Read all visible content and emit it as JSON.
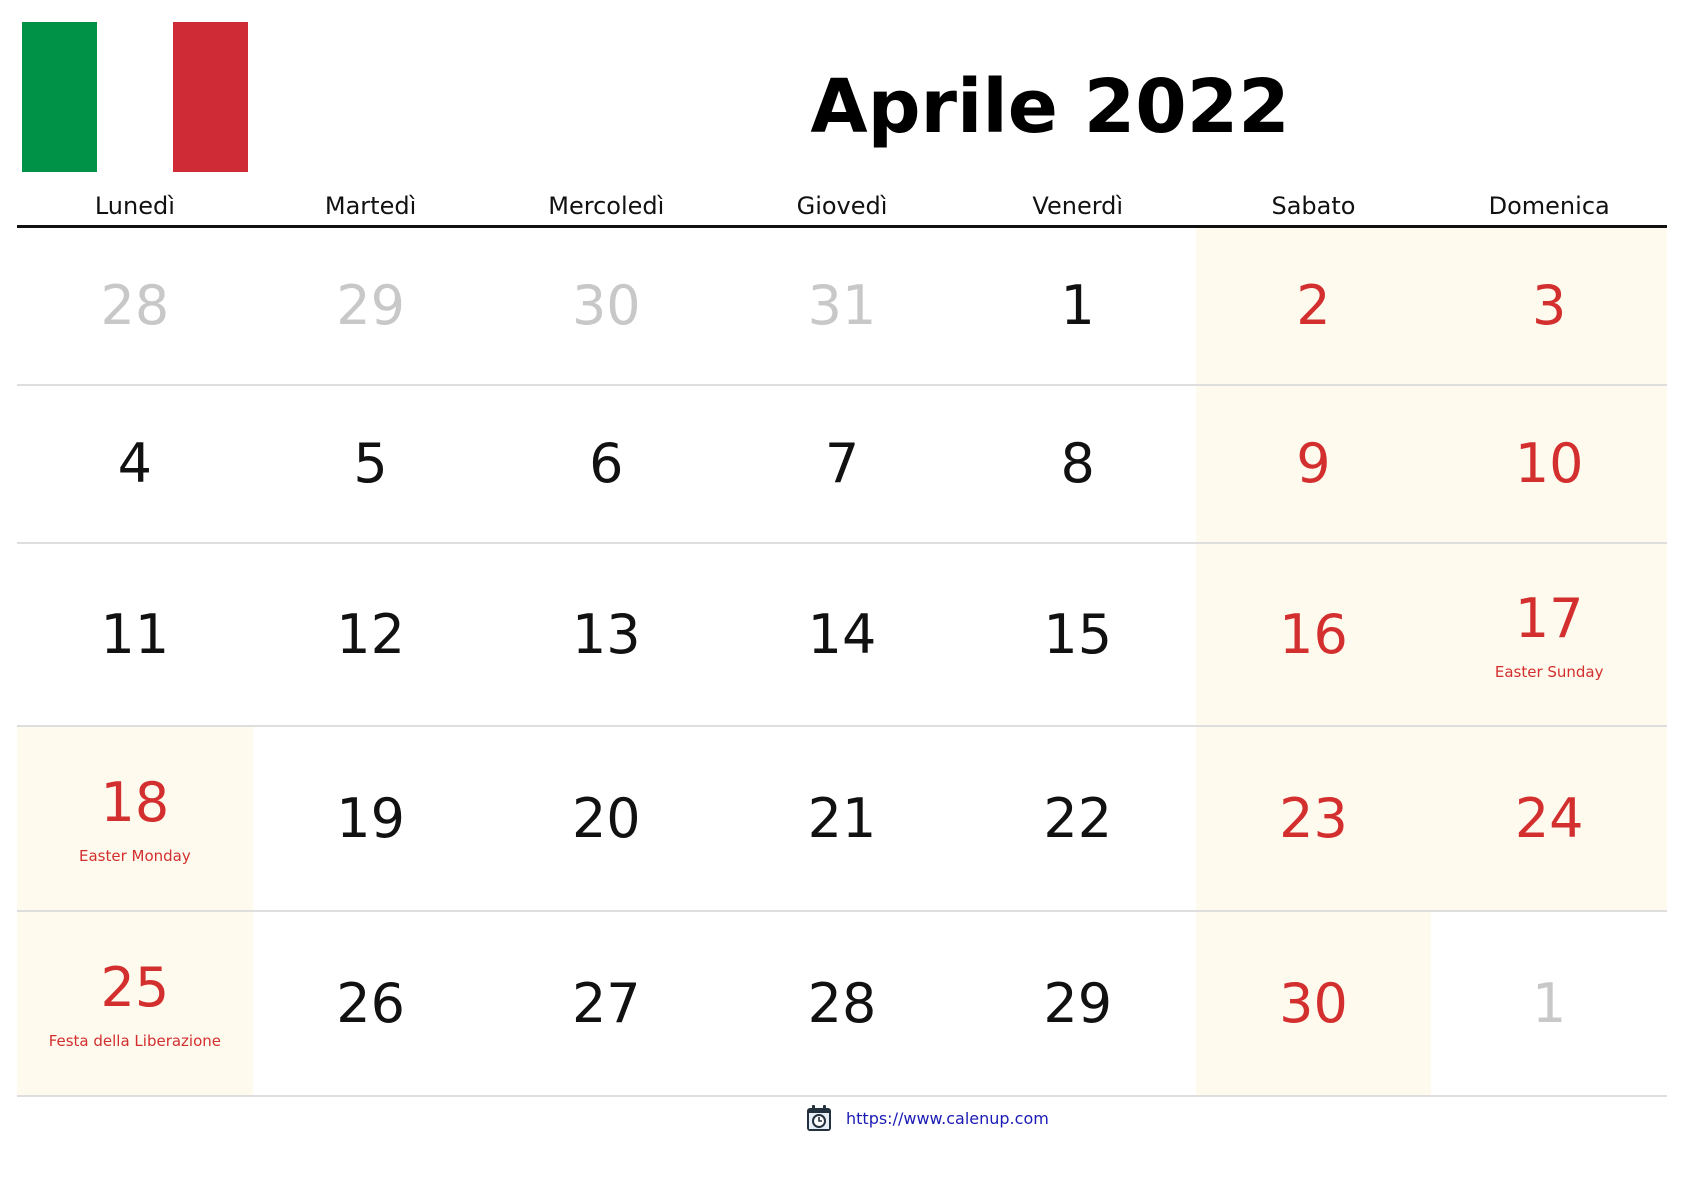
{
  "title": "Aprile 2022",
  "flag": {
    "name": "Italy",
    "colors": [
      "#009246",
      "#ffffff",
      "#ce2b37"
    ]
  },
  "weekdays": [
    "Lunedì",
    "Martedì",
    "Mercoledì",
    "Giovedì",
    "Venerdì",
    "Sabato",
    "Domenica"
  ],
  "colors": {
    "weekend_red": "#d32f2f",
    "muted_gray": "#c8c8c8",
    "weekend_shade": "#fefaee",
    "link_blue": "#1a1ab5"
  },
  "weeks": [
    [
      {
        "day": "28",
        "style": "muted",
        "shade": false
      },
      {
        "day": "29",
        "style": "muted",
        "shade": false
      },
      {
        "day": "30",
        "style": "muted",
        "shade": false
      },
      {
        "day": "31",
        "style": "muted",
        "shade": false
      },
      {
        "day": "1",
        "style": "normal",
        "shade": false
      },
      {
        "day": "2",
        "style": "red",
        "shade": true
      },
      {
        "day": "3",
        "style": "red",
        "shade": true
      }
    ],
    [
      {
        "day": "4",
        "style": "normal",
        "shade": false
      },
      {
        "day": "5",
        "style": "normal",
        "shade": false
      },
      {
        "day": "6",
        "style": "normal",
        "shade": false
      },
      {
        "day": "7",
        "style": "normal",
        "shade": false
      },
      {
        "day": "8",
        "style": "normal",
        "shade": false
      },
      {
        "day": "9",
        "style": "red",
        "shade": true
      },
      {
        "day": "10",
        "style": "red",
        "shade": true
      }
    ],
    [
      {
        "day": "11",
        "style": "normal",
        "shade": false
      },
      {
        "day": "12",
        "style": "normal",
        "shade": false
      },
      {
        "day": "13",
        "style": "normal",
        "shade": false
      },
      {
        "day": "14",
        "style": "normal",
        "shade": false
      },
      {
        "day": "15",
        "style": "normal",
        "shade": false
      },
      {
        "day": "16",
        "style": "red",
        "shade": true
      },
      {
        "day": "17",
        "style": "red",
        "shade": true,
        "holiday": "Easter Sunday"
      }
    ],
    [
      {
        "day": "18",
        "style": "red",
        "shade": true,
        "holiday": "Easter Monday"
      },
      {
        "day": "19",
        "style": "normal",
        "shade": false
      },
      {
        "day": "20",
        "style": "normal",
        "shade": false
      },
      {
        "day": "21",
        "style": "normal",
        "shade": false
      },
      {
        "day": "22",
        "style": "normal",
        "shade": false
      },
      {
        "day": "23",
        "style": "red",
        "shade": true
      },
      {
        "day": "24",
        "style": "red",
        "shade": true
      }
    ],
    [
      {
        "day": "25",
        "style": "red",
        "shade": true,
        "holiday": "Festa della Liberazione"
      },
      {
        "day": "26",
        "style": "normal",
        "shade": false
      },
      {
        "day": "27",
        "style": "normal",
        "shade": false
      },
      {
        "day": "28",
        "style": "normal",
        "shade": false
      },
      {
        "day": "29",
        "style": "normal",
        "shade": false
      },
      {
        "day": "30",
        "style": "red",
        "shade": true
      },
      {
        "day": "1",
        "style": "muted",
        "shade": false
      }
    ]
  ],
  "footer": {
    "icon": "calendar-clock-icon",
    "url_text": "https://www.calenup.com"
  }
}
